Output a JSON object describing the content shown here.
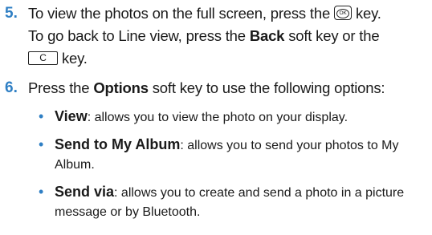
{
  "steps": [
    {
      "number": "5.",
      "line1_text": "To view the photos on the full screen, press the",
      "line1_key": "OK",
      "line1_end": "key.",
      "line2_text": "To go back to Line view, press the",
      "line2_bold": "Back",
      "line2_end": "soft key or the",
      "line3_key": "C",
      "line3_end": "key."
    },
    {
      "number": "6.",
      "pre": "Press the",
      "bold": "Options",
      "post": "soft key to use the following options:"
    }
  ],
  "options": [
    {
      "term": "View",
      "desc": ": allows you to view the photo on your display."
    },
    {
      "term": "Send to My Album",
      "desc": ": allows you to send your photos to My Album."
    },
    {
      "term": "Send via",
      "desc": ": allows you to create and send a photo in a picture message or by Bluetooth."
    }
  ],
  "colors": {
    "accent": "#2f7fc4",
    "text": "#1a1a1a"
  }
}
